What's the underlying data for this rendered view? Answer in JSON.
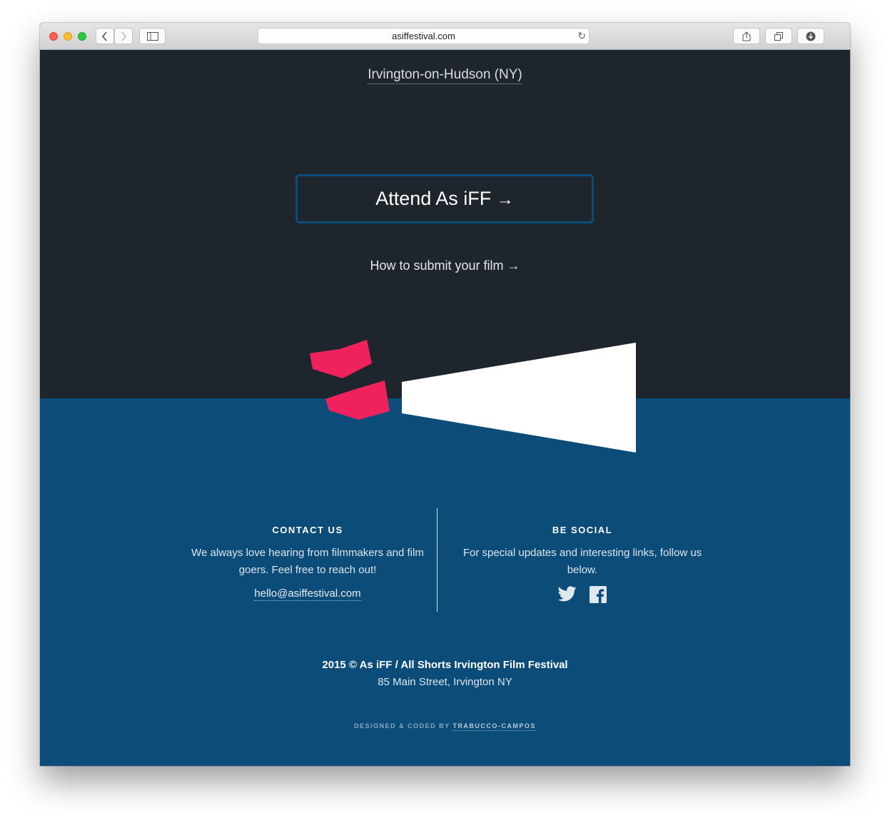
{
  "browser": {
    "url": "asiffestival.com"
  },
  "hero": {
    "location": "Irvington-on-Hudson (NY)",
    "attend_label": "Attend As iFF",
    "submit_label": "How to submit your film"
  },
  "contact": {
    "heading": "CONTACT US",
    "text": "We always love hearing from filmmakers and film goers. Feel free to reach out!",
    "email": "hello@asiffestival.com"
  },
  "social": {
    "heading": "BE SOCIAL",
    "text": "For special updates and interesting links, follow us below.",
    "icons": [
      "twitter-icon",
      "facebook-icon"
    ]
  },
  "footer": {
    "copyright": "2015 © As iFF / All Shorts Irvington Film Festival",
    "address": "85 Main Street, Irvington NY",
    "credit_prefix": "DESIGNED & CODED BY",
    "credit_link": "TRABUCCO-CAMPOS"
  },
  "colors": {
    "dark_bg": "#1f252c",
    "blue_bg": "#0c4c78",
    "accent_pink": "#f0225e"
  }
}
